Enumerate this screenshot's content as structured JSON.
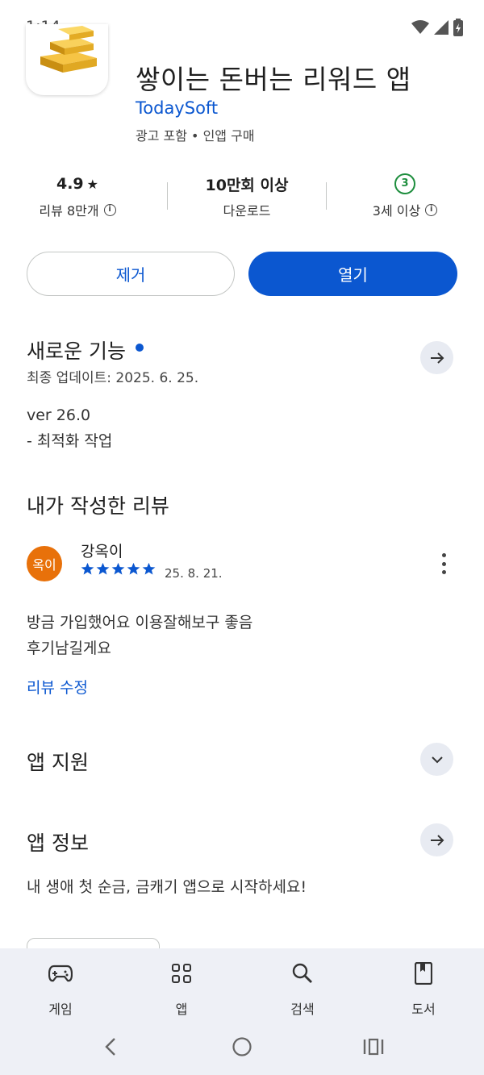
{
  "status_bar": {
    "time": "1:14",
    "icons": [
      "wifi-icon",
      "signal-icon",
      "battery-icon"
    ]
  },
  "app": {
    "title": "쌓이는 돈버는 리워드 앱",
    "developer": "TodaySoft",
    "meta": "광고 포함 • 인앱 구매"
  },
  "stats": {
    "rating": "4.9",
    "rating_star": "★",
    "reviews_label": "리뷰 8만개",
    "downloads": "10만회 이상",
    "downloads_label": "다운로드",
    "age_badge": "3",
    "age_label": "3세 이상",
    "info_glyph": "i"
  },
  "buttons": {
    "remove": "제거",
    "open": "열기"
  },
  "whats_new": {
    "title": "새로운 기능",
    "updated": "최종 업데이트: 2025. 6. 25.",
    "version": "ver 26.0",
    "notes": "- 최적화 작업"
  },
  "my_review": {
    "title": "내가 작성한 리뷰",
    "avatar_text": "옥이",
    "reviewer": "강옥이",
    "rating": 5,
    "date": "25. 8. 21.",
    "text_line1": "방금 가입했어요 이용잘해보구 좋음",
    "text_line2": "후기남길게요",
    "edit_label": "리뷰 수정"
  },
  "app_support": {
    "title": "앱 지원"
  },
  "app_info": {
    "title": "앱 정보",
    "description": "내 생애 첫 순금, 금캐기 앱으로 시작하세요!"
  },
  "bottom_nav": {
    "items": [
      {
        "label": "게임",
        "icon": "gamepad-icon"
      },
      {
        "label": "앱",
        "icon": "apps-grid-icon"
      },
      {
        "label": "검색",
        "icon": "search-icon"
      },
      {
        "label": "도서",
        "icon": "book-icon"
      }
    ]
  },
  "system_nav": [
    "back-icon",
    "home-icon",
    "recents-icon"
  ],
  "colors": {
    "accent": "#0b57d0",
    "avatar": "#e8710a",
    "age_badge": "#1e8e3e",
    "nav_bg": "#eef0f6"
  }
}
